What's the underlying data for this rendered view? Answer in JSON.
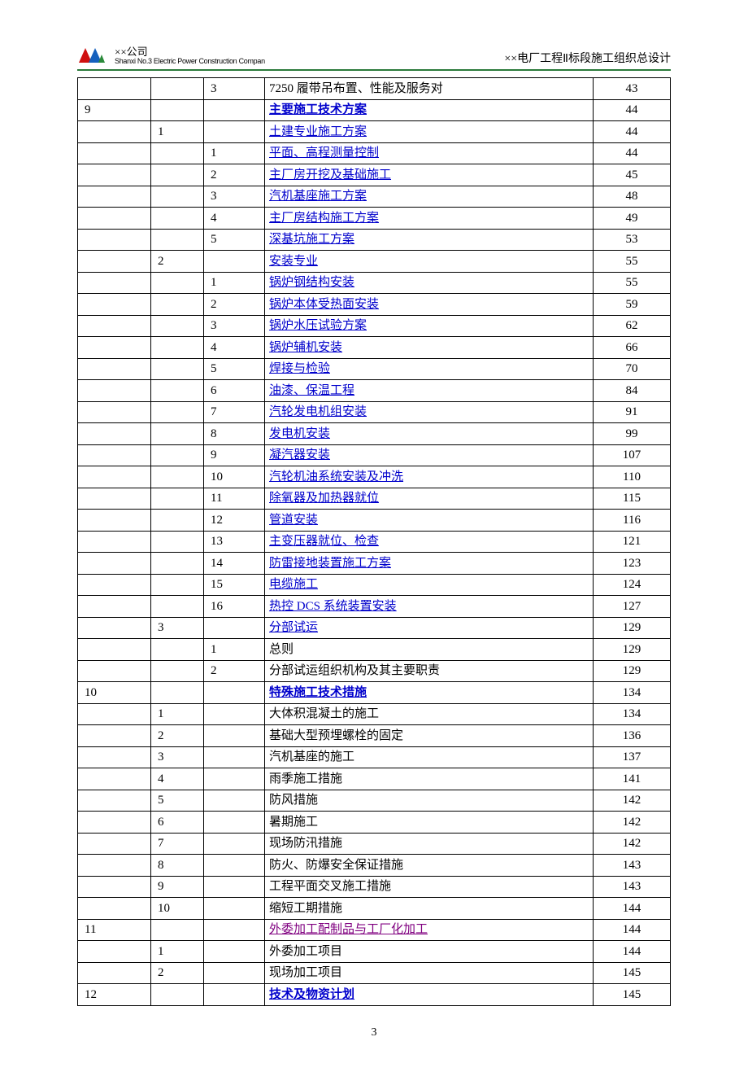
{
  "header": {
    "company_cn": "××公司",
    "company_en": "Shanxi No.3 Electric Power Construction Compan",
    "doc_title": "××电厂工程Ⅱ标段施工组织总设计"
  },
  "rows": [
    {
      "c1": "",
      "c2": "",
      "c3": "3",
      "title": "7250 履带吊布置、性能及服务对",
      "page": "43",
      "link": false,
      "bold": false
    },
    {
      "c1": "9",
      "c2": "",
      "c3": "",
      "title": "主要施工技术方案",
      "page": "44",
      "link": true,
      "bold": true
    },
    {
      "c1": "",
      "c2": "1",
      "c3": "",
      "title": "土建专业施工方案",
      "page": "44",
      "link": true,
      "bold": false
    },
    {
      "c1": "",
      "c2": "",
      "c3": "1",
      "title": "平面、高程测量控制",
      "page": "44",
      "link": true,
      "bold": false
    },
    {
      "c1": "",
      "c2": "",
      "c3": "2",
      "title": "主厂房开挖及基础施工",
      "page": "45",
      "link": true,
      "bold": false
    },
    {
      "c1": "",
      "c2": "",
      "c3": "3",
      "title": "汽机基座施工方案",
      "page": "48",
      "link": true,
      "bold": false
    },
    {
      "c1": "",
      "c2": "",
      "c3": "4",
      "title": "主厂房结构施工方案",
      "page": "49",
      "link": true,
      "bold": false
    },
    {
      "c1": "",
      "c2": "",
      "c3": "5",
      "title": "深基坑施工方案",
      "page": "53",
      "link": true,
      "bold": false
    },
    {
      "c1": "",
      "c2": "2",
      "c3": "",
      "title": "安装专业",
      "page": "55",
      "link": true,
      "bold": false
    },
    {
      "c1": "",
      "c2": "",
      "c3": "1",
      "title": "锅炉钢结构安装",
      "page": "55",
      "link": true,
      "bold": false
    },
    {
      "c1": "",
      "c2": "",
      "c3": "2",
      "title": "锅炉本体受热面安装",
      "page": "59",
      "link": true,
      "bold": false
    },
    {
      "c1": "",
      "c2": "",
      "c3": "3",
      "title": "锅炉水压试验方案",
      "page": "62",
      "link": true,
      "bold": false
    },
    {
      "c1": "",
      "c2": "",
      "c3": "4",
      "title": "锅炉辅机安装",
      "page": "66",
      "link": true,
      "bold": false
    },
    {
      "c1": "",
      "c2": "",
      "c3": "5",
      "title": "焊接与检验",
      "page": "70",
      "link": true,
      "bold": false
    },
    {
      "c1": "",
      "c2": "",
      "c3": "6",
      "title": "油漆、保温工程",
      "page": "84",
      "link": true,
      "bold": false
    },
    {
      "c1": "",
      "c2": "",
      "c3": "7",
      "title": "汽轮发电机组安装",
      "page": "91",
      "link": true,
      "bold": false
    },
    {
      "c1": "",
      "c2": "",
      "c3": "8",
      "title": "发电机安装",
      "page": "99",
      "link": true,
      "bold": false
    },
    {
      "c1": "",
      "c2": "",
      "c3": "9",
      "title": "凝汽器安装 ",
      "page": "107",
      "link": true,
      "bold": false
    },
    {
      "c1": "",
      "c2": "",
      "c3": "10",
      "title": "汽轮机油系统安装及冲洗",
      "page": "110",
      "link": true,
      "bold": false
    },
    {
      "c1": "",
      "c2": "",
      "c3": "11",
      "title": "除氧器及加热器就位",
      "page": "115",
      "link": true,
      "bold": false
    },
    {
      "c1": "",
      "c2": "",
      "c3": "12",
      "title": "管道安装",
      "page": "116",
      "link": true,
      "bold": false
    },
    {
      "c1": "",
      "c2": "",
      "c3": "13",
      "title": "主变压器就位、检查",
      "page": "121",
      "link": true,
      "bold": false
    },
    {
      "c1": "",
      "c2": "",
      "c3": "14",
      "title": "防雷接地装置施工方案",
      "page": "123",
      "link": true,
      "bold": false
    },
    {
      "c1": "",
      "c2": "",
      "c3": "15",
      "title": "电缆施工",
      "page": "124",
      "link": true,
      "bold": false
    },
    {
      "c1": "",
      "c2": "",
      "c3": "16",
      "title": "热控 DCS 系统装置安装",
      "page": "127",
      "link": true,
      "bold": false
    },
    {
      "c1": "",
      "c2": "3",
      "c3": "",
      "title": "分部试运",
      "page": "129",
      "link": true,
      "bold": false
    },
    {
      "c1": "",
      "c2": "",
      "c3": "1",
      "title": "总则",
      "page": "129",
      "link": false,
      "bold": false
    },
    {
      "c1": "",
      "c2": "",
      "c3": "2",
      "title": "分部试运组织机构及其主要职责",
      "page": "129",
      "link": false,
      "bold": false
    },
    {
      "c1": "10",
      "c2": "",
      "c3": "",
      "title": "特殊施工技术措施",
      "page": "134",
      "link": true,
      "bold": true
    },
    {
      "c1": "",
      "c2": "1",
      "c3": "",
      "title": "大体积混凝土的施工",
      "page": "134",
      "link": false,
      "bold": false
    },
    {
      "c1": "",
      "c2": "2",
      "c3": "",
      "title": "基础大型预埋螺栓的固定",
      "page": "136",
      "link": false,
      "bold": false
    },
    {
      "c1": "",
      "c2": "3",
      "c3": "",
      "title": "汽机基座的施工",
      "page": "137",
      "link": false,
      "bold": false
    },
    {
      "c1": "",
      "c2": "4",
      "c3": "",
      "title": "雨季施工措施",
      "page": "141",
      "link": false,
      "bold": false
    },
    {
      "c1": "",
      "c2": "5",
      "c3": "",
      "title": "防风措施",
      "page": "142",
      "link": false,
      "bold": false
    },
    {
      "c1": "",
      "c2": "6",
      "c3": "",
      "title": "暑期施工",
      "page": "142",
      "link": false,
      "bold": false
    },
    {
      "c1": "",
      "c2": "7",
      "c3": "",
      "title": "现场防汛措施",
      "page": "142",
      "link": false,
      "bold": false
    },
    {
      "c1": "",
      "c2": "8",
      "c3": "",
      "title": "防火、防爆安全保证措施",
      "page": "143",
      "link": false,
      "bold": false
    },
    {
      "c1": "",
      "c2": "9",
      "c3": "",
      "title": "工程平面交叉施工措施",
      "page": "143",
      "link": false,
      "bold": false
    },
    {
      "c1": "",
      "c2": "10",
      "c3": "",
      "title": "缩短工期措施",
      "page": "144",
      "link": false,
      "bold": false
    },
    {
      "c1": "11",
      "c2": "",
      "c3": "",
      "title": "外委加工配制品与工厂化加工",
      "page": "144",
      "link": true,
      "vlink": true,
      "bold": false
    },
    {
      "c1": "",
      "c2": "1",
      "c3": "",
      "title": "外委加工项目",
      "page": "144",
      "link": false,
      "bold": false
    },
    {
      "c1": "",
      "c2": "2",
      "c3": "",
      "title": "现场加工项目",
      "page": "145",
      "link": false,
      "bold": false
    },
    {
      "c1": "12",
      "c2": "",
      "c3": "",
      "title": "技术及物资计划",
      "page": "145",
      "link": true,
      "bold": true
    }
  ],
  "page_number": "3"
}
